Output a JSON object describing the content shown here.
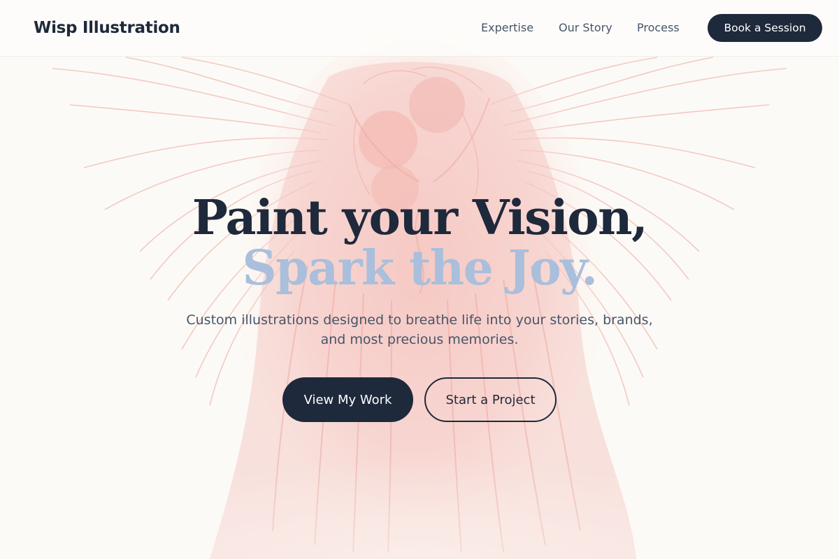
{
  "brand": {
    "name": "Wisp Illustration"
  },
  "nav": {
    "links": [
      "Expertise",
      "Our Story",
      "Process"
    ],
    "cta_label": "Book a Session"
  },
  "hero": {
    "title_line1": "Paint your Vision,",
    "title_line2": "Spark the Joy.",
    "subtitle": "Custom illustrations designed to breathe life into your stories, brands, and most precious memories.",
    "primary_button": "View My Work",
    "secondary_button": "Start a Project"
  },
  "colors": {
    "ink": "#1e293b",
    "accent_blue": "#a9bfdc",
    "muted_text": "#475569",
    "background": "#fcfaf6",
    "artwork_tint": "#eea8a2"
  },
  "icons": {
    "background_art": "winged-angels-engraving-illustration"
  }
}
